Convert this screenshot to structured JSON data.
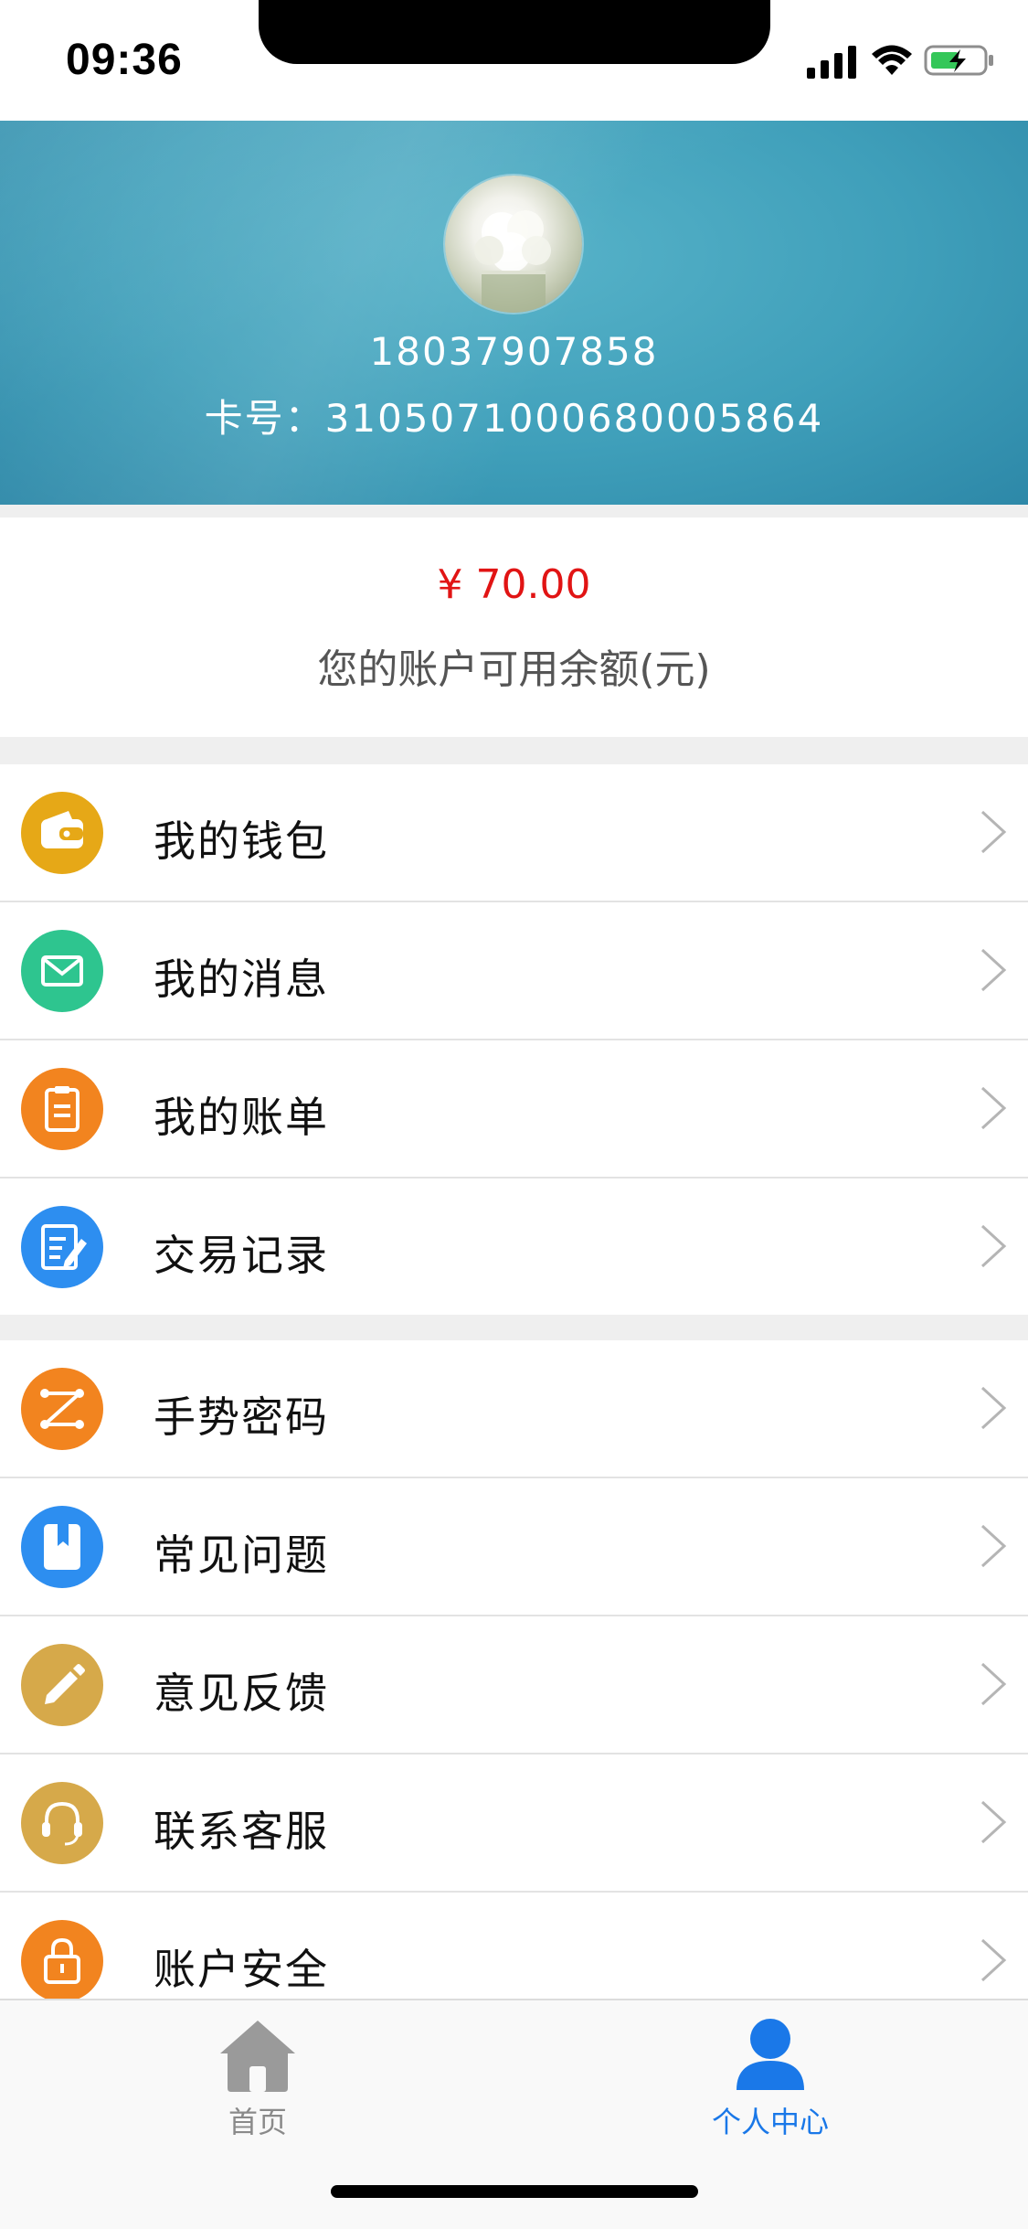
{
  "status_bar": {
    "time": "09:36",
    "icons": [
      "signal-icon",
      "wifi-icon",
      "battery-charging-icon"
    ]
  },
  "header": {
    "phone": "18037907858",
    "card_label": "卡号：",
    "card_number": "3105071000680005864",
    "card_text": "卡号：3105071000680005864"
  },
  "balance": {
    "amount": "¥ 70.00",
    "label": "您的账户可用余额(元)"
  },
  "menu_group_1": [
    {
      "label": "我的钱包",
      "icon": "wallet-icon",
      "color": "#e6a817"
    },
    {
      "label": "我的消息",
      "icon": "mail-icon",
      "color": "#2ec58f"
    },
    {
      "label": "我的账单",
      "icon": "clipboard-icon",
      "color": "#f2841f"
    },
    {
      "label": "交易记录",
      "icon": "edit-document-icon",
      "color": "#2d8ef0"
    }
  ],
  "menu_group_2": [
    {
      "label": "手势密码",
      "icon": "gesture-icon",
      "color": "#f2841f"
    },
    {
      "label": "常见问题",
      "icon": "book-icon",
      "color": "#2d8ef0"
    },
    {
      "label": "意见反馈",
      "icon": "pencil-icon",
      "color": "#d6a94a"
    },
    {
      "label": "联系客服",
      "icon": "headset-icon",
      "color": "#d6a94a"
    },
    {
      "label": "账户安全",
      "icon": "lock-icon",
      "color": "#f2841f"
    }
  ],
  "tab_bar": {
    "tabs": [
      {
        "label": "首页",
        "icon": "home-icon",
        "active": false
      },
      {
        "label": "个人中心",
        "icon": "user-icon",
        "active": true
      }
    ],
    "active_color": "#1a78e8",
    "inactive_color": "#8a8a8a"
  },
  "colors": {
    "header_bg": "#3f9fba",
    "balance_amount": "#e11414"
  }
}
